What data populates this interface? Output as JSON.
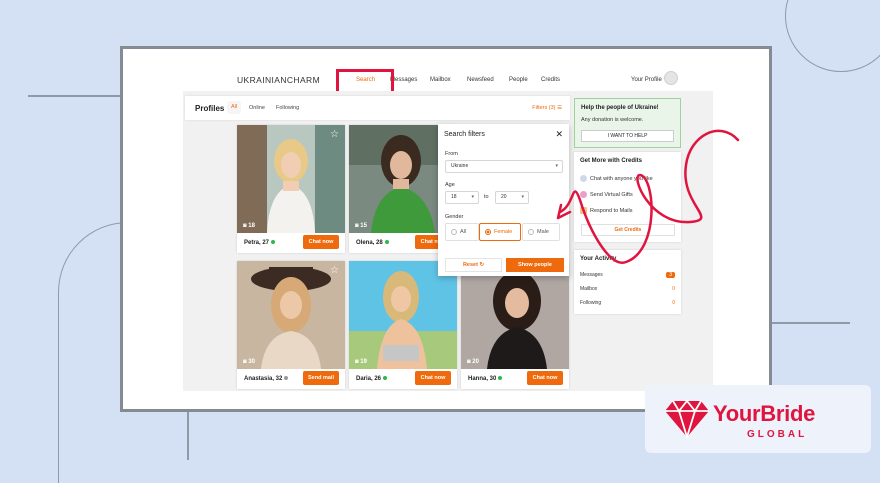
{
  "colors": {
    "accent": "#ef6a0c",
    "brand": "#e0153f",
    "online": "#2db84b",
    "highlight_box": "#e0153f"
  },
  "header": {
    "logo": "UKRAINIANCHARM",
    "nav": [
      {
        "label": "Search",
        "active": true
      },
      {
        "label": "Messages"
      },
      {
        "label": "Mailbox"
      },
      {
        "label": "Newsfeed"
      },
      {
        "label": "People"
      },
      {
        "label": "Credits"
      }
    ],
    "your_profile": "Your Profile"
  },
  "profiles": {
    "title": "Profiles",
    "tabs": [
      "All",
      "Online",
      "Following"
    ],
    "filters_link": "Filters (3)",
    "cards": [
      {
        "name": "Petra, 27",
        "photos": "18",
        "button": "Chat now",
        "online": true,
        "star": true
      },
      {
        "name": "Olena, 28",
        "photos": "15",
        "button": "Chat now",
        "online": true,
        "star": false
      },
      {
        "name": "Anastasia, 32",
        "photos": "30",
        "button": "Send mail",
        "online": false,
        "star": true
      },
      {
        "name": "Daria, 26",
        "photos": "19",
        "button": "Chat now",
        "online": true,
        "star": false
      },
      {
        "name": "Hanna, 30",
        "photos": "20",
        "button": "Chat now",
        "online": true,
        "star": false
      }
    ]
  },
  "search_filters": {
    "title": "Search filters",
    "from_label": "From",
    "from_value": "Ukraine",
    "age_label": "Age",
    "age_from": "18",
    "age_to_label": "to",
    "age_to": "20",
    "gender_label": "Gender",
    "gender_options": [
      "All",
      "Female",
      "Male"
    ],
    "gender_selected": "Female",
    "reset": "Reset",
    "show": "Show people"
  },
  "sidebar": {
    "ukraine": {
      "title": "Help the people of Ukraine!",
      "text": "Any donation is welcome.",
      "button": "I WANT TO HELP"
    },
    "credits": {
      "title": "Get More with Credits",
      "items": [
        "Chat with anyone you like",
        "Send Virtual Gifts",
        "Respond to Mails"
      ],
      "button": "Get Credits"
    },
    "activity": {
      "title": "Your Activity",
      "rows": [
        {
          "label": "Messages",
          "value": "3"
        },
        {
          "label": "Mailbox",
          "value": "0"
        },
        {
          "label": "Following",
          "value": "0"
        }
      ]
    }
  },
  "brand": {
    "name": "YourBride",
    "sub": "GLOBAL"
  }
}
